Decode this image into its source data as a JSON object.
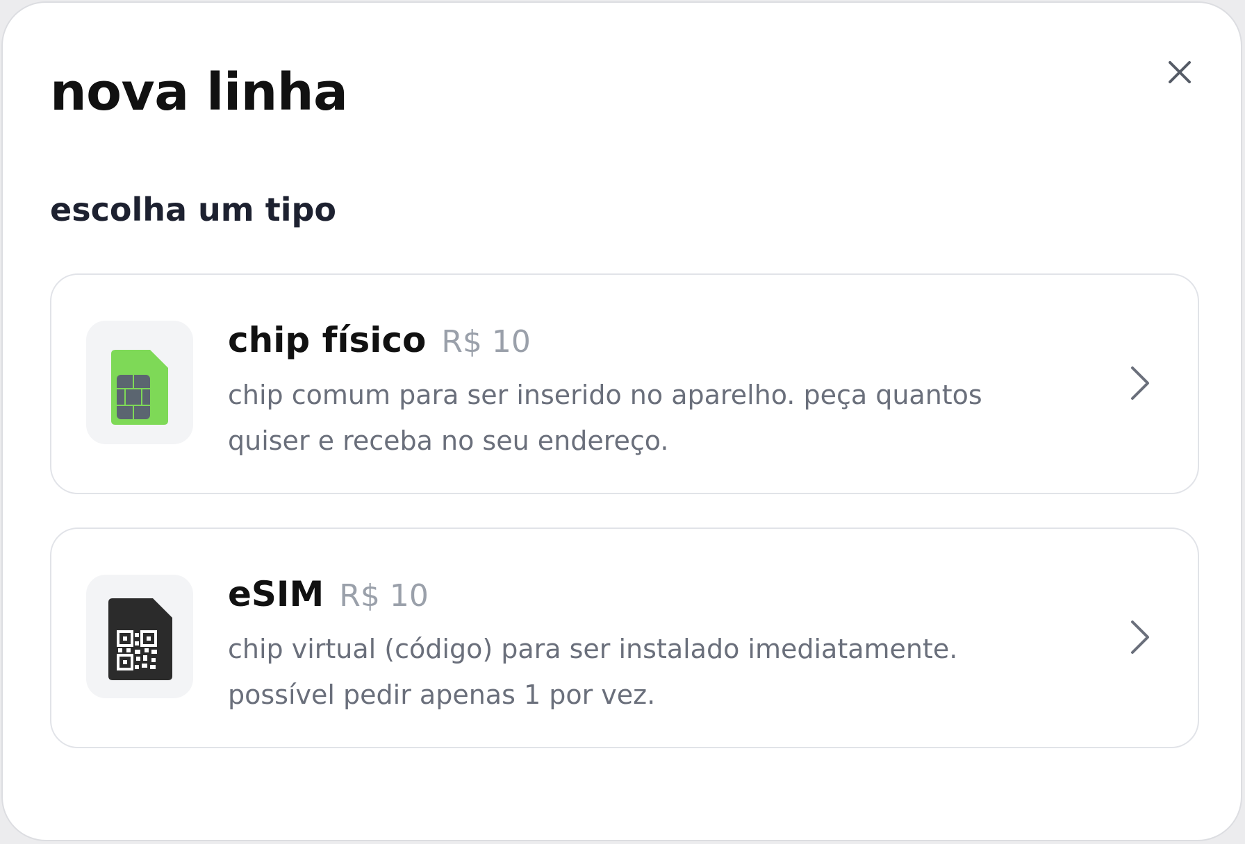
{
  "modal": {
    "title": "nova linha",
    "subtitle": "escolha um tipo",
    "close_icon": "close-icon"
  },
  "options": [
    {
      "name": "chip físico",
      "price": "R$ 10",
      "description": "chip comum para ser inserido no aparelho. peça quantos quiser e receba no seu endereço.",
      "icon": "sim-card-icon",
      "icon_color": "#7ed957"
    },
    {
      "name": "eSIM",
      "price": "R$ 10",
      "description": "chip virtual (código) para ser instalado imediatamente. possível pedir apenas 1 por vez.",
      "icon": "esim-qr-icon",
      "icon_color": "#2b2b2b"
    }
  ],
  "colors": {
    "text_primary": "#111111",
    "text_secondary": "#6a6f7b",
    "price": "#9aa0aa",
    "border": "#e1e3e8"
  }
}
